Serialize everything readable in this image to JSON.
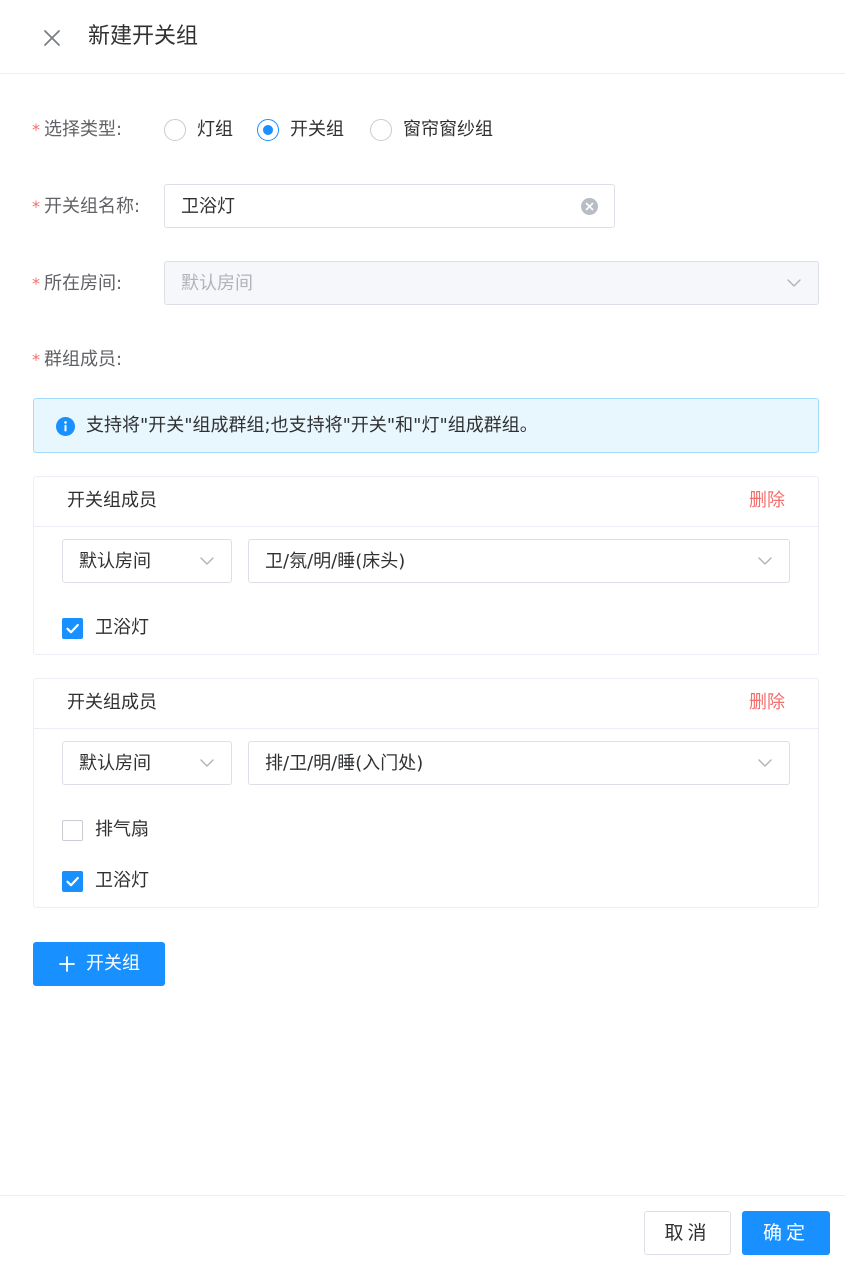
{
  "dialog": {
    "title": "新建开关组"
  },
  "form": {
    "type_label": "选择类型:",
    "type_options": [
      {
        "label": "灯组",
        "checked": false
      },
      {
        "label": "开关组",
        "checked": true
      },
      {
        "label": "窗帘窗纱组",
        "checked": false
      }
    ],
    "name_label": "开关组名称:",
    "name_value": "卫浴灯",
    "room_label": "所在房间:",
    "room_value": "默认房间",
    "members_label": "群组成员:"
  },
  "alert": {
    "text": "支持将\"开关\"组成群组;也支持将\"开关\"和\"灯\"组成群组。"
  },
  "members": [
    {
      "title": "开关组成员",
      "delete_label": "删除",
      "room": "默认房间",
      "device": "卫/氛/明/睡(床头)",
      "options": [
        {
          "label": "卫浴灯",
          "checked": true
        }
      ]
    },
    {
      "title": "开关组成员",
      "delete_label": "删除",
      "room": "默认房间",
      "device": "排/卫/明/睡(入门处)",
      "options": [
        {
          "label": "排气扇",
          "checked": false
        },
        {
          "label": "卫浴灯",
          "checked": true
        }
      ]
    }
  ],
  "add_button": {
    "label": "开关组"
  },
  "footer": {
    "cancel_label": "取消",
    "ok_label": "确定"
  },
  "colors": {
    "primary": "#1890ff",
    "danger": "#f56c6c",
    "alert_bg": "#e8f6fe"
  },
  "icons": {
    "close": "close-icon",
    "clear": "clear-icon",
    "chevron": "chevron-down-icon",
    "info": "info-icon",
    "check": "check-icon",
    "plus": "plus-icon"
  }
}
